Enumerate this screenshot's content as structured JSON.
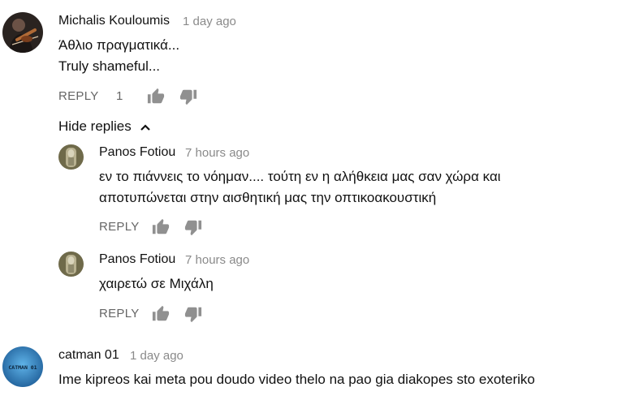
{
  "comments": [
    {
      "author": "Michalis Kouloumis",
      "time": "1 day ago",
      "lines": [
        "Άθλιο πραγματικά...",
        "Truly shameful..."
      ],
      "reply_label": "REPLY",
      "like_count": "1",
      "avatar_icon": "violinist-avatar"
    },
    {
      "author": "catman 01",
      "time": "1 day ago",
      "lines": [
        "Ime kipreos kai meta pou doudo video thelo na pao gia diakopes sto exoteriko"
      ],
      "avatar_icon": "catman-avatar",
      "avatar_text": "CATMAN 01"
    }
  ],
  "replies_toggle": {
    "label": "Hide replies",
    "icon": "chevron-up-icon"
  },
  "replies": [
    {
      "author": "Panos Fotiou",
      "time": "7 hours ago",
      "lines": [
        "εν το πιάννεις το νόημαν.... τούτη εν η αλήθκεια μας σαν χώρα και",
        "αποτυπώνεται στην αισθητική μας την οπτικοακουστική"
      ],
      "reply_label": "REPLY",
      "avatar_icon": "statue-avatar"
    },
    {
      "author": "Panos Fotiou",
      "time": "7 hours ago",
      "lines": [
        "χαιρετώ σε Μιχάλη"
      ],
      "reply_label": "REPLY",
      "avatar_icon": "statue-avatar"
    }
  ],
  "colors": {
    "text": "#111111",
    "meta": "#8a8a8a",
    "action": "#666666",
    "icon": "#909090"
  }
}
